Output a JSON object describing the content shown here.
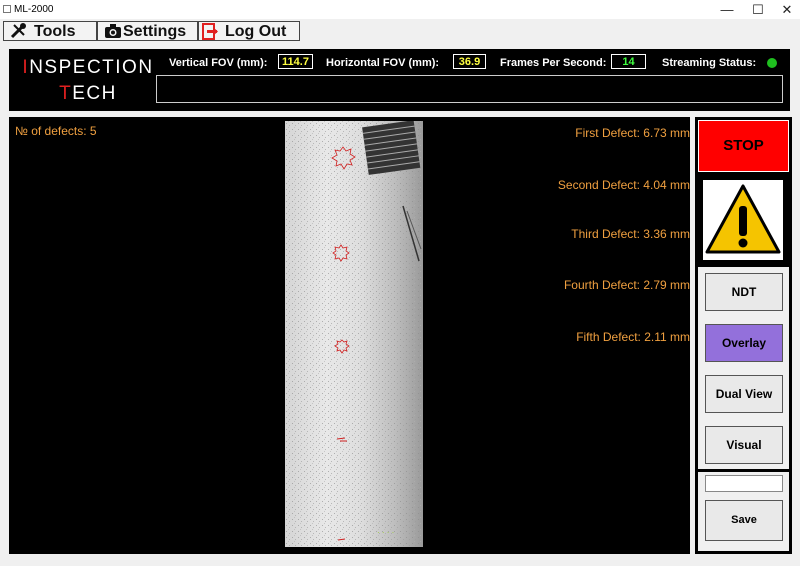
{
  "window": {
    "title": "ML-2000",
    "minimize_glyph": "—",
    "maximize_glyph": "☐",
    "close_glyph": "✕"
  },
  "menu": {
    "tools_label": "Tools",
    "settings_label": "Settings",
    "logout_label": "Log Out",
    "tools_icon": "tools-icon",
    "settings_icon": "camera-icon",
    "logout_icon": "logout-icon"
  },
  "logo": {
    "line1_first": "I",
    "line1_rest": "NSPECTION",
    "line2_first": "T",
    "line2_rest": "ECH"
  },
  "stats": {
    "vertical_fov_label": "Vertical FOV (mm):",
    "vertical_fov_value": "114.7",
    "horizontal_fov_label": "Horizontal FOV (mm):",
    "horizontal_fov_value": "36.9",
    "fps_label": "Frames Per Second:",
    "fps_value": "14",
    "streaming_label": "Streaming Status:",
    "streaming_color": "#1fbf1f"
  },
  "colors": {
    "value_yellow": "#ffff40",
    "value_green": "#40ff40",
    "defect_text": "#f0a040",
    "stop_red": "#ff0000",
    "active_purple": "#9370db",
    "warning_yellow": "#f5c400"
  },
  "defects": {
    "count_label": "№ of defects: 5",
    "items": [
      "First Defect: 6.73 mm",
      "Second Defect: 4.04 mm",
      "Third Defect: 3.36 mm",
      "Fourth Defect: 2.79 mm",
      "Fifth Defect: 2.11 mm"
    ]
  },
  "sidebar": {
    "stop_label": "STOP",
    "warning_icon": "warning-icon",
    "modes": [
      {
        "label": "NDT",
        "active": false
      },
      {
        "label": "Overlay",
        "active": true
      },
      {
        "label": "Dual View",
        "active": false
      },
      {
        "label": "Visual",
        "active": false
      }
    ],
    "save_input_value": "",
    "save_label": "Save"
  }
}
